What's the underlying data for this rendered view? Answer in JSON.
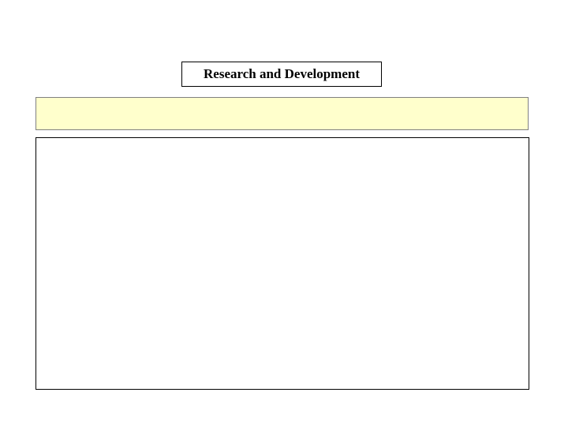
{
  "slide": {
    "title": "Research and Development"
  },
  "colors": {
    "banner_fill": "#FFFFCC",
    "title_border": "#000000",
    "content_border": "#000000"
  }
}
